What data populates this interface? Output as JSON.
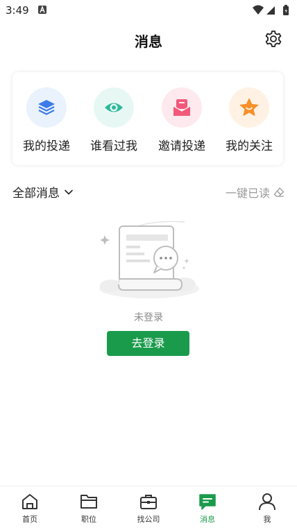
{
  "status_bar": {
    "time": "3:49"
  },
  "header": {
    "title": "消息"
  },
  "quick_actions": [
    {
      "label": "我的投递",
      "icon": "layers-icon",
      "bg": "#e9f2fd",
      "color": "#3d7be8"
    },
    {
      "label": "谁看过我",
      "icon": "eye-icon",
      "bg": "#e7f8f4",
      "color": "#2bb99a"
    },
    {
      "label": "邀请投递",
      "icon": "envelope-icon",
      "bg": "#fde9ee",
      "color": "#f0597a"
    },
    {
      "label": "我的关注",
      "icon": "star-icon",
      "bg": "#fff2e5",
      "color": "#f7902a"
    }
  ],
  "filter": {
    "dropdown_label": "全部消息",
    "mark_read_label": "一键已读"
  },
  "empty_state": {
    "message": "未登录",
    "login_button": "去登录"
  },
  "bottom_nav": {
    "active_index": 3,
    "accent": "#1a9b4c",
    "items": [
      {
        "label": "首页",
        "icon": "home-icon"
      },
      {
        "label": "职位",
        "icon": "folder-icon"
      },
      {
        "label": "找公司",
        "icon": "briefcase-icon"
      },
      {
        "label": "消息",
        "icon": "message-icon"
      },
      {
        "label": "我",
        "icon": "person-icon"
      }
    ]
  }
}
